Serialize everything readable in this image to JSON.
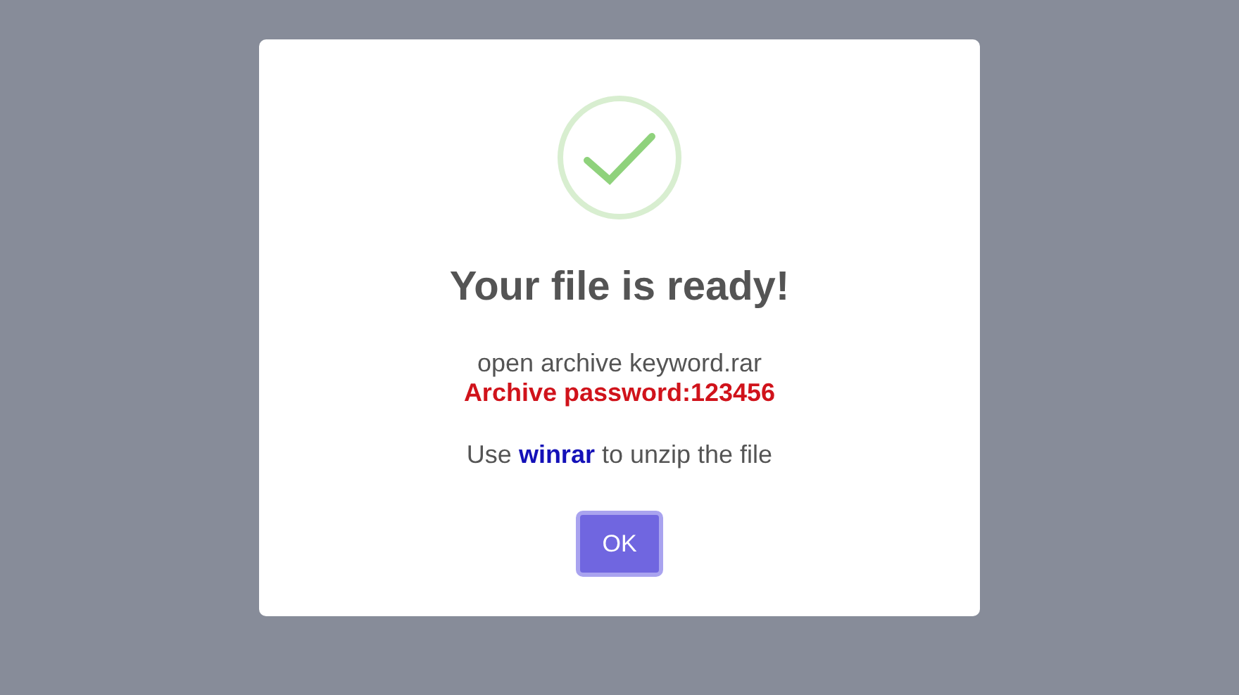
{
  "dialog": {
    "title": "Your file is ready!",
    "lines": [
      {
        "text": "open archive keyword.rar",
        "kind": "plain"
      },
      {
        "text": "Archive password:123456",
        "kind": "alert"
      },
      {
        "text": "Use **winrar** to unzip the file",
        "kind": "hint"
      }
    ],
    "button": "OK"
  }
}
